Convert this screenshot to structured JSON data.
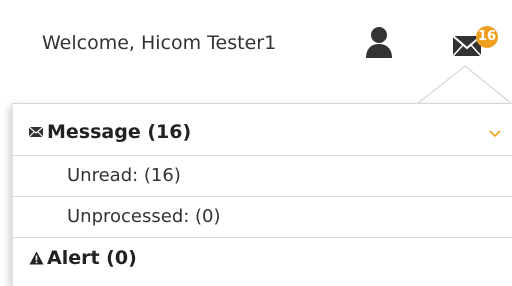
{
  "header": {
    "welcome_text": "Welcome, Hicom Tester1",
    "user_icon": "user-icon",
    "mail_icon": "envelope-icon",
    "mail_badge": "16",
    "badge_color": "#f0a020"
  },
  "dropdown": {
    "message": {
      "icon": "envelope-small-icon",
      "label": "Message (16)",
      "expand_icon": "chevron-down-icon",
      "chevron_color": "#f0a020",
      "items": [
        {
          "label": "Unread: (16)"
        },
        {
          "label": "Unprocessed: (0)"
        }
      ]
    },
    "alert": {
      "icon": "warning-icon",
      "label": "Alert (0)"
    }
  }
}
